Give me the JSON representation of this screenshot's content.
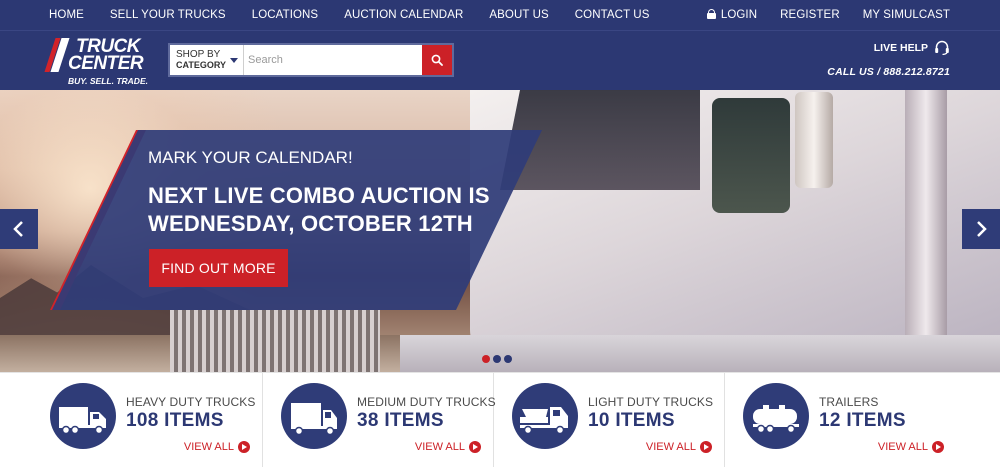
{
  "topnav": {
    "left": [
      "HOME",
      "SELL YOUR TRUCKS",
      "LOCATIONS",
      "AUCTION CALENDAR",
      "ABOUT US",
      "CONTACT US"
    ],
    "login": "LOGIN",
    "register": "REGISTER",
    "simulcast": "MY SIMULCAST"
  },
  "header": {
    "logo_line1": "TRUCK",
    "logo_line2": "CENTER",
    "logo_tagline": "BUY. SELL. TRADE.",
    "shopby_line1": "SHOP BY",
    "shopby_line2": "CATEGORY",
    "search_placeholder": "Search",
    "live_help": "LIVE HELP",
    "call_us": "CALL US / 888.212.8721"
  },
  "hero": {
    "kicker": "MARK YOUR CALENDAR!",
    "headline": "NEXT LIVE COMBO AUCTION IS WEDNESDAY, OCTOBER 12TH",
    "cta": "FIND OUT MORE",
    "slides": 3,
    "active_slide": 1
  },
  "categories": [
    {
      "title": "HEAVY DUTY TRUCKS",
      "count": "108 ITEMS",
      "link": "VIEW ALL",
      "icon": "heavy-truck-icon"
    },
    {
      "title": "MEDIUM DUTY TRUCKS",
      "count": "38 ITEMS",
      "link": "VIEW ALL",
      "icon": "box-truck-icon"
    },
    {
      "title": "LIGHT DUTY TRUCKS",
      "count": "10 ITEMS",
      "link": "VIEW ALL",
      "icon": "flatbed-truck-icon"
    },
    {
      "title": "TRAILERS",
      "count": "12 ITEMS",
      "link": "VIEW ALL",
      "icon": "tanker-trailer-icon"
    }
  ],
  "colors": {
    "navy": "#2c3873",
    "red": "#cc2127",
    "dot_active": "#cc2127",
    "dot_inactive": "#2c3873"
  }
}
